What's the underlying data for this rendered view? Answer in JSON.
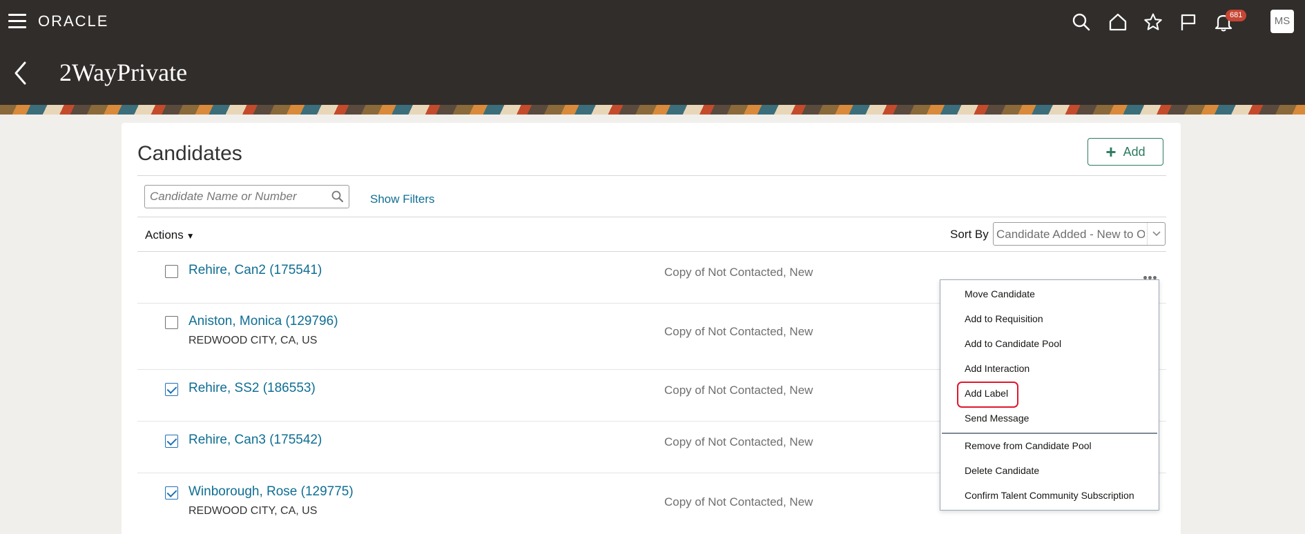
{
  "header": {
    "brand": "ORACLE",
    "page_title": "2WayPrivate",
    "notification_count": "681",
    "user_initials": "MS",
    "icons": [
      "menu-icon",
      "search-icon",
      "home-icon",
      "star-icon",
      "flag-icon",
      "bell-icon"
    ]
  },
  "card": {
    "title": "Candidates",
    "add_label": "Add",
    "search_placeholder": "Candidate Name or Number",
    "show_filters": "Show Filters",
    "actions_label": "Actions",
    "sort_by_label": "Sort By",
    "sort_by_value": "Candidate Added - New to Old"
  },
  "candidates": [
    {
      "name": "Rehire, Can2 (175541)",
      "location": "",
      "status": "Copy of Not Contacted, New",
      "checked": false
    },
    {
      "name": "Aniston, Monica (129796)",
      "location": "REDWOOD CITY, CA, US",
      "status": "Copy of Not Contacted, New",
      "checked": false
    },
    {
      "name": "Rehire, SS2 (186553)",
      "location": "",
      "status": "Copy of Not Contacted, New",
      "checked": true
    },
    {
      "name": "Rehire, Can3 (175542)",
      "location": "",
      "status": "Copy of Not Contacted, New",
      "checked": true
    },
    {
      "name": "Winborough, Rose (129775)",
      "location": "REDWOOD CITY, CA, US",
      "status": "Copy of Not Contacted, New",
      "checked": true
    }
  ],
  "context_menu": {
    "items": [
      "Move Candidate",
      "Add to Requisition",
      "Add to Candidate Pool",
      "Add Interaction",
      "Add Label",
      "Send Message",
      "Remove from Candidate Pool",
      "Delete Candidate",
      "Confirm Talent Community Subscription"
    ],
    "highlighted": "Add Label",
    "highlight_color": "#e0162b"
  },
  "colors": {
    "header_bg": "#312d2a",
    "link": "#0f6e93",
    "accent_green": "#2d7a5e",
    "badge": "#c74634"
  }
}
